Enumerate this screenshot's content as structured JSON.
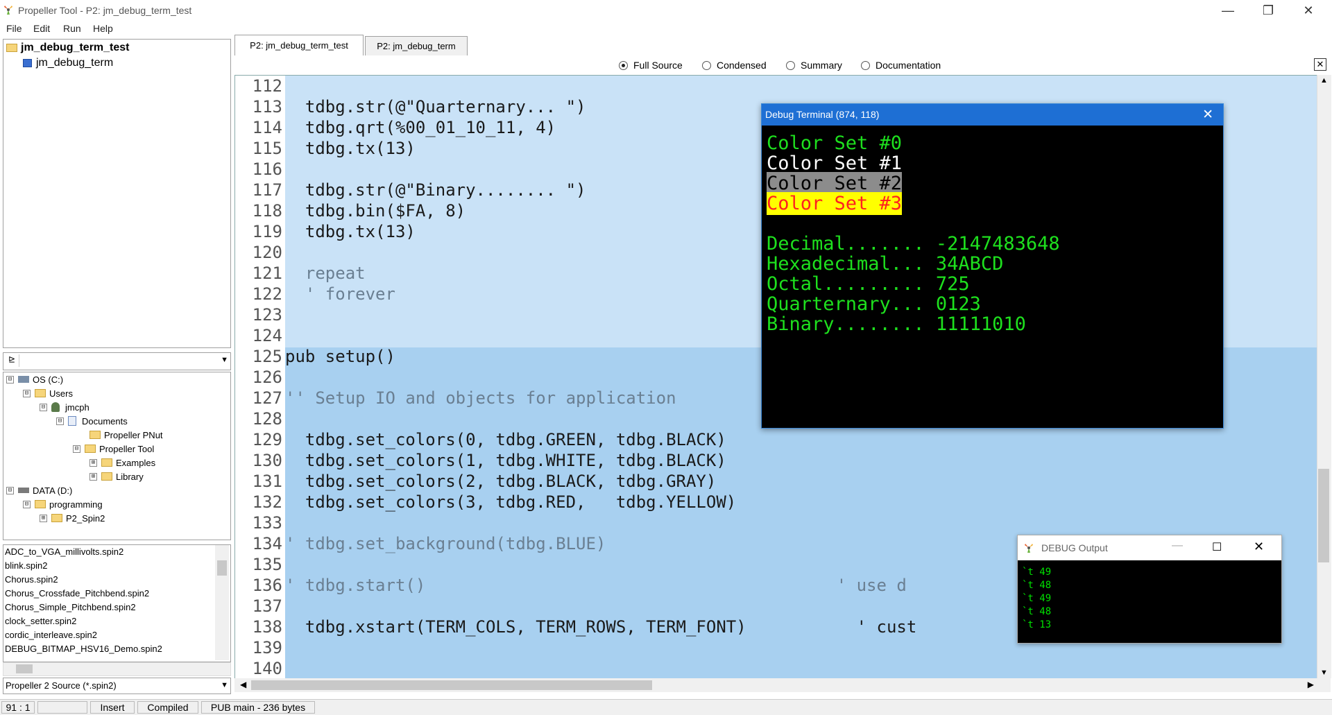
{
  "window": {
    "title": "Propeller Tool - P2: jm_debug_term_test",
    "minimize": "—",
    "maximize": "❐",
    "close": "✕"
  },
  "menu": [
    "File",
    "Edit",
    "Run",
    "Help"
  ],
  "project_tree": {
    "root": "jm_debug_term_test",
    "child": "jm_debug_term"
  },
  "directory_tree": [
    {
      "label": "OS (C:)",
      "exp": "⊟"
    },
    {
      "label": "Users",
      "exp": "⊟"
    },
    {
      "label": "jmcph",
      "exp": "⊟"
    },
    {
      "label": "Documents",
      "exp": "⊟"
    },
    {
      "label": "Propeller PNut",
      "exp": ""
    },
    {
      "label": "Propeller Tool",
      "exp": "⊟"
    },
    {
      "label": "Examples",
      "exp": "⊞"
    },
    {
      "label": "Library",
      "exp": "⊞"
    },
    {
      "label": "DATA (D:)",
      "exp": "⊟"
    },
    {
      "label": "programming",
      "exp": "⊟"
    },
    {
      "label": "P2_Spin2",
      "exp": "⊞"
    }
  ],
  "file_list": [
    "ADC_to_VGA_millivolts.spin2",
    "blink.spin2",
    "Chorus.spin2",
    "Chorus_Crossfade_Pitchbend.spin2",
    "Chorus_Simple_Pitchbend.spin2",
    "clock_setter.spin2",
    "cordic_interleave.spin2",
    "DEBUG_BITMAP_HSV16_Demo.spin2"
  ],
  "file_filter": "Propeller 2 Source (*.spin2)",
  "tabs": [
    "P2: jm_debug_term_test",
    "P2: jm_debug_term"
  ],
  "view_modes": [
    "Full Source",
    "Condensed",
    "Summary",
    "Documentation"
  ],
  "selected_view_mode": "Full Source",
  "editor_lines": [
    {
      "n": "112",
      "t": ""
    },
    {
      "n": "113",
      "t": "  tdbg.str(@\"Quarternary... \")"
    },
    {
      "n": "114",
      "t": "  tdbg.qrt(%00_01_10_11, 4)"
    },
    {
      "n": "115",
      "t": "  tdbg.tx(13)"
    },
    {
      "n": "116",
      "t": ""
    },
    {
      "n": "117",
      "t": "  tdbg.str(@\"Binary........ \")"
    },
    {
      "n": "118",
      "t": "  tdbg.bin($FA, 8)"
    },
    {
      "n": "119",
      "t": "  tdbg.tx(13)"
    },
    {
      "n": "120",
      "t": ""
    },
    {
      "n": "121",
      "t": "  repeat"
    },
    {
      "n": "122",
      "t": "  ' forever"
    },
    {
      "n": "123",
      "t": ""
    },
    {
      "n": "124",
      "t": ""
    },
    {
      "n": "125",
      "t": "pub setup()"
    },
    {
      "n": "126",
      "t": ""
    },
    {
      "n": "127",
      "t": "'' Setup IO and objects for application"
    },
    {
      "n": "128",
      "t": ""
    },
    {
      "n": "129",
      "t": "  tdbg.set_colors(0, tdbg.GREEN, tdbg.BLACK)"
    },
    {
      "n": "130",
      "t": "  tdbg.set_colors(1, tdbg.WHITE, tdbg.BLACK)"
    },
    {
      "n": "131",
      "t": "  tdbg.set_colors(2, tdbg.BLACK, tdbg.GRAY)"
    },
    {
      "n": "132",
      "t": "  tdbg.set_colors(3, tdbg.RED,   tdbg.YELLOW)"
    },
    {
      "n": "133",
      "t": ""
    },
    {
      "n": "134",
      "t": "' tdbg.set_background(tdbg.BLUE)"
    },
    {
      "n": "135",
      "t": ""
    },
    {
      "n": "136",
      "t": "' tdbg.start()                                         ' use d"
    },
    {
      "n": "137",
      "t": ""
    },
    {
      "n": "138",
      "t": "  tdbg.xstart(TERM_COLS, TERM_ROWS, TERM_FONT)           ' cust"
    },
    {
      "n": "139",
      "t": ""
    },
    {
      "n": "140",
      "t": ""
    }
  ],
  "debug_terminal": {
    "title": "Debug Terminal (874, 118)",
    "lines": [
      {
        "text": "Color Set #0",
        "fg": "#1ee01e",
        "bg": ""
      },
      {
        "text": "Color Set #1",
        "fg": "#ffffff",
        "bg": ""
      },
      {
        "text": "Color Set #2",
        "fg": "#000000",
        "bg": "#8c8c8c"
      },
      {
        "text": "Color Set #3",
        "fg": "#ff2020",
        "bg": "#ffff00"
      },
      {
        "text": "",
        "fg": "#1ee01e",
        "bg": ""
      },
      {
        "text": "Decimal....... -2147483648",
        "fg": "#1ee01e",
        "bg": ""
      },
      {
        "text": "Hexadecimal... 34ABCD",
        "fg": "#1ee01e",
        "bg": ""
      },
      {
        "text": "Octal......... 725",
        "fg": "#1ee01e",
        "bg": ""
      },
      {
        "text": "Quarternary... 0123",
        "fg": "#1ee01e",
        "bg": ""
      },
      {
        "text": "Binary........ 11111010",
        "fg": "#1ee01e",
        "bg": ""
      }
    ]
  },
  "debug_output": {
    "title": "DEBUG Output",
    "lines": [
      "`t 49",
      "`t 48",
      "`t 49",
      "`t 48",
      "`t 13"
    ]
  },
  "status": {
    "position": "91 : 1",
    "blank": "",
    "mode": "Insert",
    "compiled": "Compiled",
    "info": "PUB main  -  236 bytes"
  }
}
